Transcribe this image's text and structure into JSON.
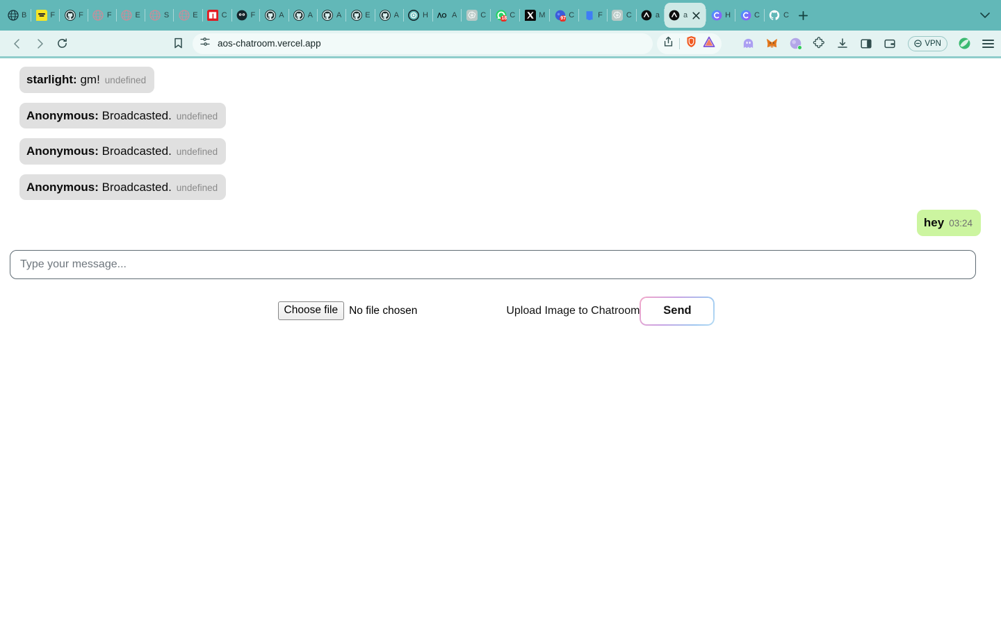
{
  "browser": {
    "tabs": [
      {
        "title": "B",
        "icon": "globe-dark-icon",
        "active": false
      },
      {
        "title": "F",
        "icon": "yellow-note-icon",
        "active": false
      },
      {
        "title": "F",
        "icon": "github-icon",
        "active": false
      },
      {
        "title": "F",
        "icon": "globe-pink-icon",
        "active": false
      },
      {
        "title": "E",
        "icon": "globe-pink-icon",
        "active": false
      },
      {
        "title": "S",
        "icon": "globe-pink-icon",
        "active": false
      },
      {
        "title": "E",
        "icon": "globe-pink-icon",
        "active": false
      },
      {
        "title": "C",
        "icon": "npm-red-icon",
        "active": false
      },
      {
        "title": "F",
        "icon": "dark-circle-icon",
        "active": false
      },
      {
        "title": "A",
        "icon": "github-icon",
        "active": false
      },
      {
        "title": "A",
        "icon": "github-icon",
        "active": false
      },
      {
        "title": "A",
        "icon": "github-icon",
        "active": false
      },
      {
        "title": "E",
        "icon": "github-icon",
        "active": false
      },
      {
        "title": "A",
        "icon": "github-icon",
        "active": false
      },
      {
        "title": "H",
        "icon": "target-icon",
        "active": false
      },
      {
        "title": "A",
        "icon": "ao-icon",
        "active": false
      },
      {
        "title": "C",
        "icon": "openai-icon",
        "active": false
      },
      {
        "title": "C",
        "icon": "whatsapp-icon",
        "badge": "18",
        "active": false
      },
      {
        "title": "M",
        "icon": "x-twitter-icon",
        "active": false
      },
      {
        "title": "C",
        "icon": "blue-badge-icon",
        "badge": "97",
        "active": false
      },
      {
        "title": "F",
        "icon": "figma-blue-icon",
        "active": false
      },
      {
        "title": "C",
        "icon": "openai-icon",
        "active": false
      },
      {
        "title": "a",
        "icon": "arweave-black-icon",
        "active": false
      },
      {
        "title": "a",
        "icon": "arweave-black-icon",
        "active": true
      },
      {
        "title": "H",
        "icon": "copilot-icon",
        "active": false
      },
      {
        "title": "C",
        "icon": "copilot-icon",
        "active": false
      },
      {
        "title": "C",
        "icon": "github-white-icon",
        "active": false
      }
    ],
    "new_tab_label": "+",
    "tab_search_label": "⌄",
    "nav": {
      "back_label": "‹",
      "forward_label": "›",
      "reload_label": "⟳",
      "bookmark_label": "bookmark",
      "url": "aos-chatroom.vercel.app",
      "site_settings_icon": "sliders-icon",
      "share_icon": "share-icon",
      "brave_shield_icon": "brave-shield-icon",
      "leo_icon": "leo-triangle-icon"
    },
    "extensions": [
      {
        "name": "phantom-wallet-icon"
      },
      {
        "name": "metamask-fox-icon"
      },
      {
        "name": "wallet-purple-icon"
      },
      {
        "name": "puzzle-extensions-icon"
      },
      {
        "name": "downloads-icon"
      },
      {
        "name": "sidebar-toggle-icon"
      },
      {
        "name": "wallet-card-icon"
      }
    ],
    "vpn_label": "VPN",
    "leaf_icon": "brave-leo-leaf-icon",
    "menu_icon": "hamburger-menu-icon"
  },
  "chat": {
    "messages": [
      {
        "sender": "starlight:",
        "text": "gm!",
        "time": "undefined",
        "outgoing": false
      },
      {
        "sender": "Anonymous:",
        "text": "Broadcasted.",
        "time": "undefined",
        "outgoing": false
      },
      {
        "sender": "Anonymous:",
        "text": "Broadcasted.",
        "time": "undefined",
        "outgoing": false
      },
      {
        "sender": "Anonymous:",
        "text": "Broadcasted.",
        "time": "undefined",
        "outgoing": false
      },
      {
        "sender": "",
        "text": "hey",
        "time": "03:24",
        "outgoing": true
      }
    ],
    "composer": {
      "placeholder": "Type your message...",
      "value": "",
      "choose_file_label": "Choose file",
      "no_file_label": "No file chosen",
      "upload_label": "Upload Image to Chatroom",
      "send_label": "Send"
    }
  },
  "colors": {
    "tabstrip_bg": "#62b8b8",
    "navbar_bg": "#e4f3f2",
    "active_tab_bg": "#cfe9e6",
    "incoming_bubble": "#e0e0e0",
    "outgoing_bubble": "#ccf5a0",
    "send_gradient_start": "#f2a7c8",
    "send_gradient_end": "#b7dbf4"
  }
}
